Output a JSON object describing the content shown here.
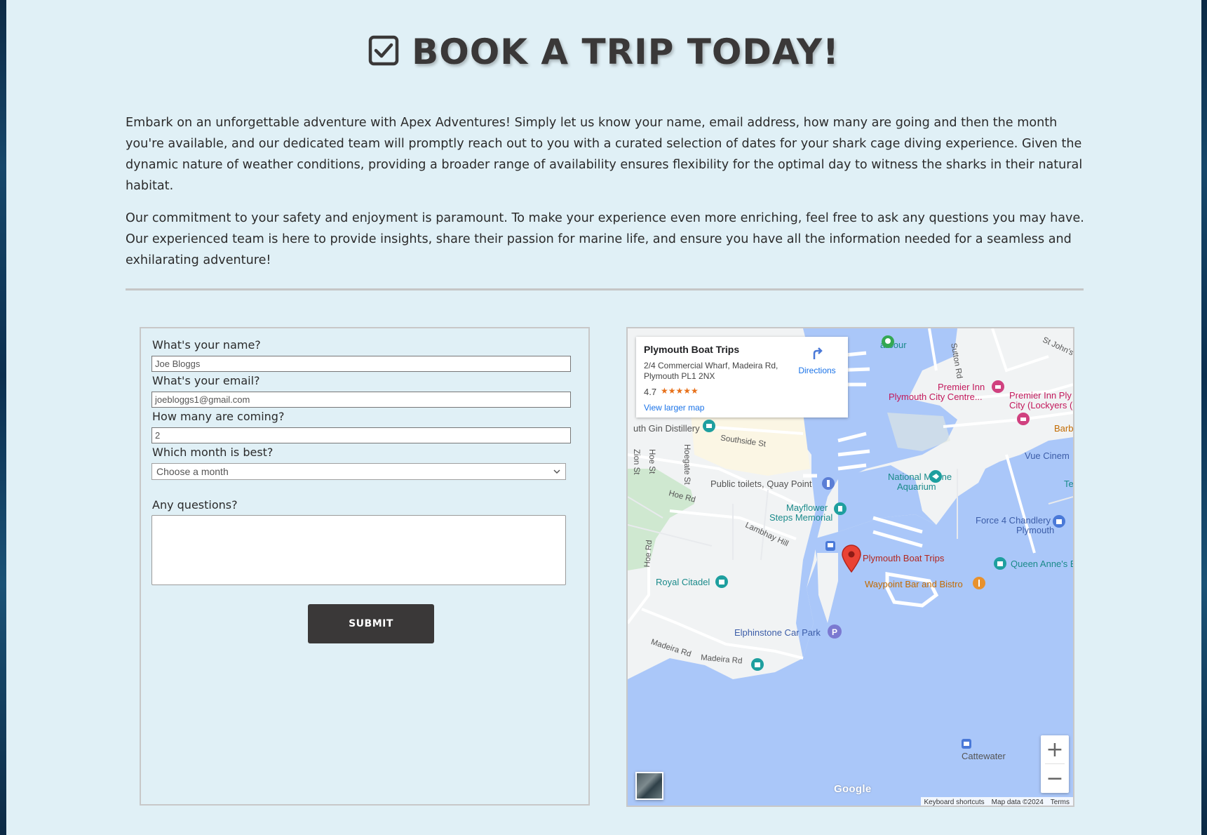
{
  "page": {
    "title": "BOOK A TRIP TODAY!",
    "title_icon": "checkbox-checked-icon",
    "intro_paragraphs": [
      "Embark on an unforgettable adventure with Apex Adventures! Simply let us know your name, email address, how many are going and then the month you're available, and our dedicated team will promptly reach out to you with a curated selection of dates for your shark cage diving experience. Given the dynamic nature of weather conditions, providing a broader range of availability ensures flexibility for the optimal day to witness the sharks in their natural habitat.",
      "Our commitment to your safety and enjoyment is paramount. To make your experience even more enriching, feel free to ask any questions you may have. Our experienced team is here to provide insights, share their passion for marine life, and ensure you have all the information needed for a seamless and exhilarating adventure!"
    ]
  },
  "form": {
    "name_label": "What's your name?",
    "name_placeholder": "Joe Bloggs",
    "email_label": "What's your email?",
    "email_placeholder": "joebloggs1@gmail.com",
    "count_label": "How many are coming?",
    "count_value": "2",
    "month_label": "Which month is best?",
    "month_selected": "Choose a month",
    "questions_label": "Any questions?",
    "questions_value": "",
    "submit_label": "SUBMIT"
  },
  "map": {
    "card": {
      "title": "Plymouth Boat Trips",
      "address": "2/4 Commercial Wharf, Madeira Rd, Plymouth PL1 2NX",
      "rating": "4.7",
      "stars": "★★★★★",
      "view_larger": "View larger map",
      "directions": "Directions"
    },
    "labels": {
      "gin_distillery": "uth Gin Distillery",
      "southside": "Southside St",
      "public_toilets": "Public toilets, Quay Point",
      "national_marine": "National Marine",
      "aquarium": "Aquarium",
      "mayflower_1": "Mayflower",
      "mayflower_2": "Steps Memorial",
      "hoe_rd": "Hoe Rd",
      "hoe_rd_v": "Hoe Rd",
      "lambhay": "Lambhay Hill",
      "royal_citadel": "Royal Citadel",
      "plymouth_boat_trips": "Plymouth Boat Trips",
      "waypoint": "Waypoint Bar and Bistro",
      "elphinstone": "Elphinstone Car Park",
      "madeira_1": "Madeira Rd",
      "madeira_2": "Madeira Rd",
      "premier_inn_1": "Premier Inn",
      "premier_inn_2": "Plymouth City Centre...",
      "premier_inn_3": "Premier Inn Ply",
      "premier_inn_4": "City (Lockyers (",
      "vue": "Vue Cinem",
      "force4_1": "Force 4 Chandlery",
      "force4_2": "Plymouth",
      "queen_annes": "Queen Anne's B",
      "barb": "Barb",
      "te": "Te",
      "harbour": "arbour",
      "sutton": "Sutton Rd",
      "st_johns": "St John's",
      "zion": "Zion St",
      "hoe_st": "Hoe St",
      "hoegate": "Hoegate St",
      "cattewater": "Cattewater"
    },
    "google": "Google",
    "attribution": {
      "shortcuts": "Keyboard shortcuts",
      "map_data": "Map data ©2024",
      "terms": "Terms"
    }
  }
}
